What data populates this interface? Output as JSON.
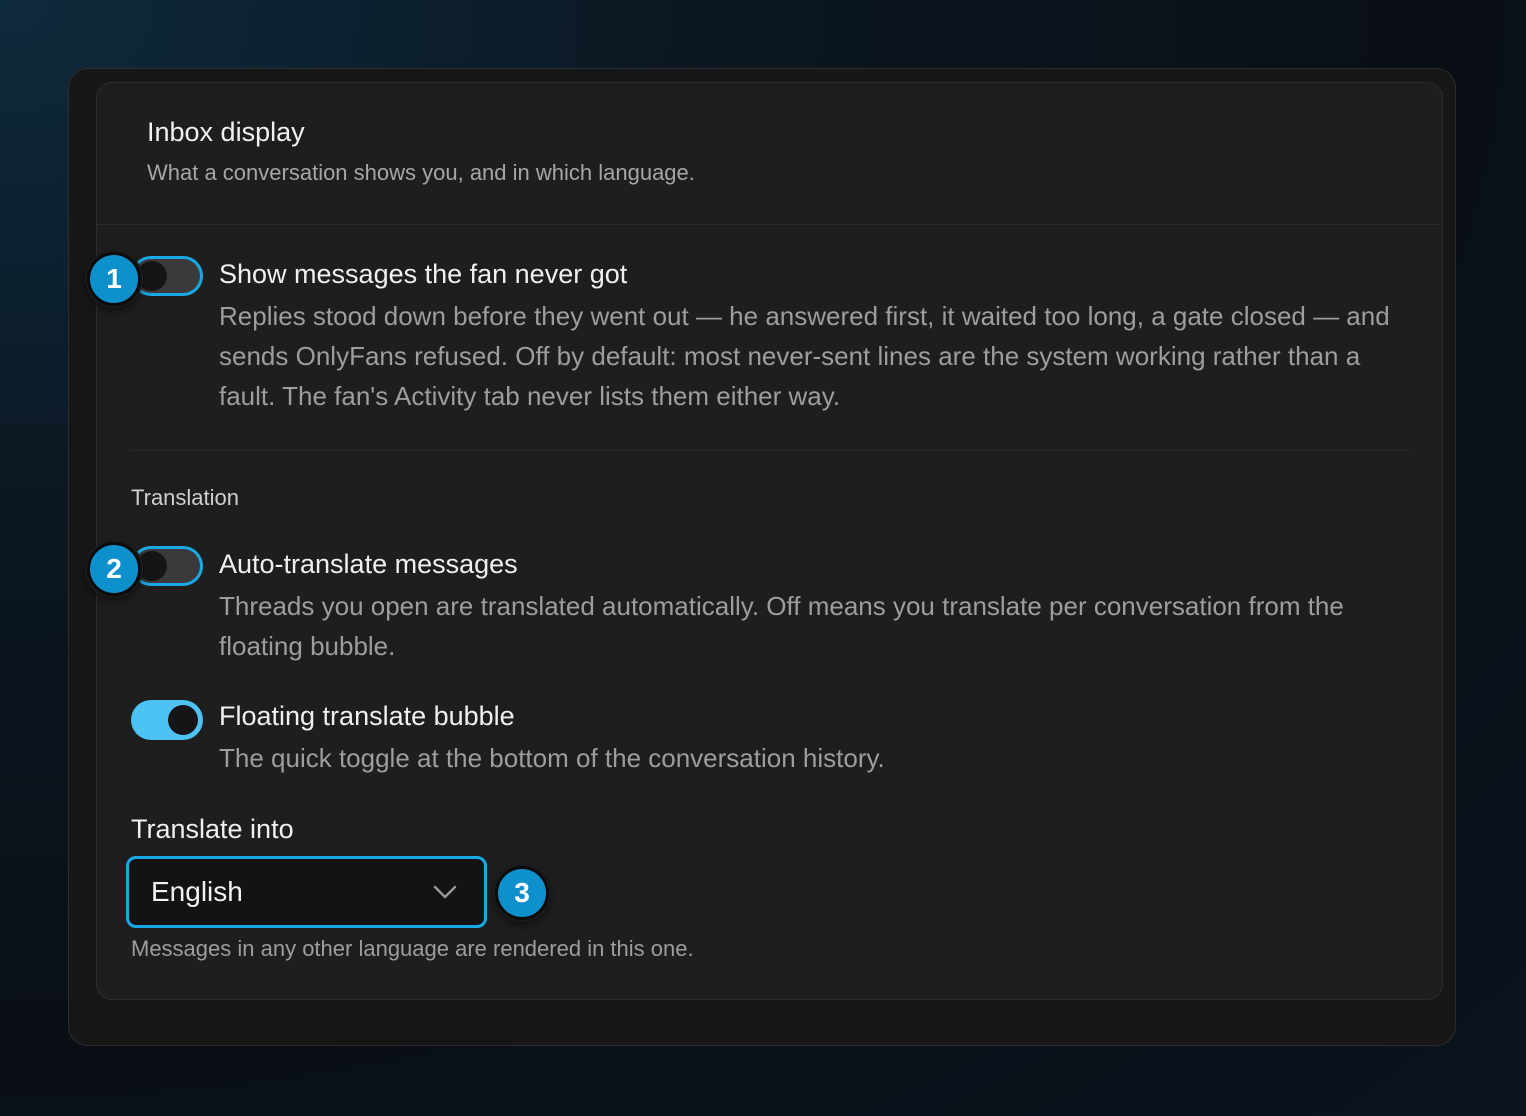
{
  "card": {
    "title": "Inbox display",
    "subtitle": "What a conversation shows you, and in which language."
  },
  "options": [
    {
      "title": "Show messages the fan never got",
      "description": "Replies stood down before they went out — he answered first, it waited too long, a gate closed — and sends OnlyFans refused. Off by default: most never-sent lines are the system working rather than a fault. The fan's Activity tab never lists them either way.",
      "enabled": false
    },
    {
      "title": "Auto-translate messages",
      "description": "Threads you open are translated automatically. Off means you translate per conversation from the floating bubble.",
      "enabled": false
    },
    {
      "title": "Floating translate bubble",
      "description": "The quick toggle at the bottom of the conversation history.",
      "enabled": true
    }
  ],
  "translation": {
    "section_label": "Translation",
    "field_label": "Translate into",
    "selected_language": "English",
    "hint": "Messages in any other language are rendered in this one."
  },
  "badges": [
    "1",
    "2",
    "3"
  ],
  "colors": {
    "accent": "#1aa8e4",
    "toggle_on": "#4cc3f3",
    "badge": "#0e90cc",
    "card_bg": "#1e1e1e"
  },
  "icons": {
    "select_arrow": "chevron-down-icon"
  }
}
